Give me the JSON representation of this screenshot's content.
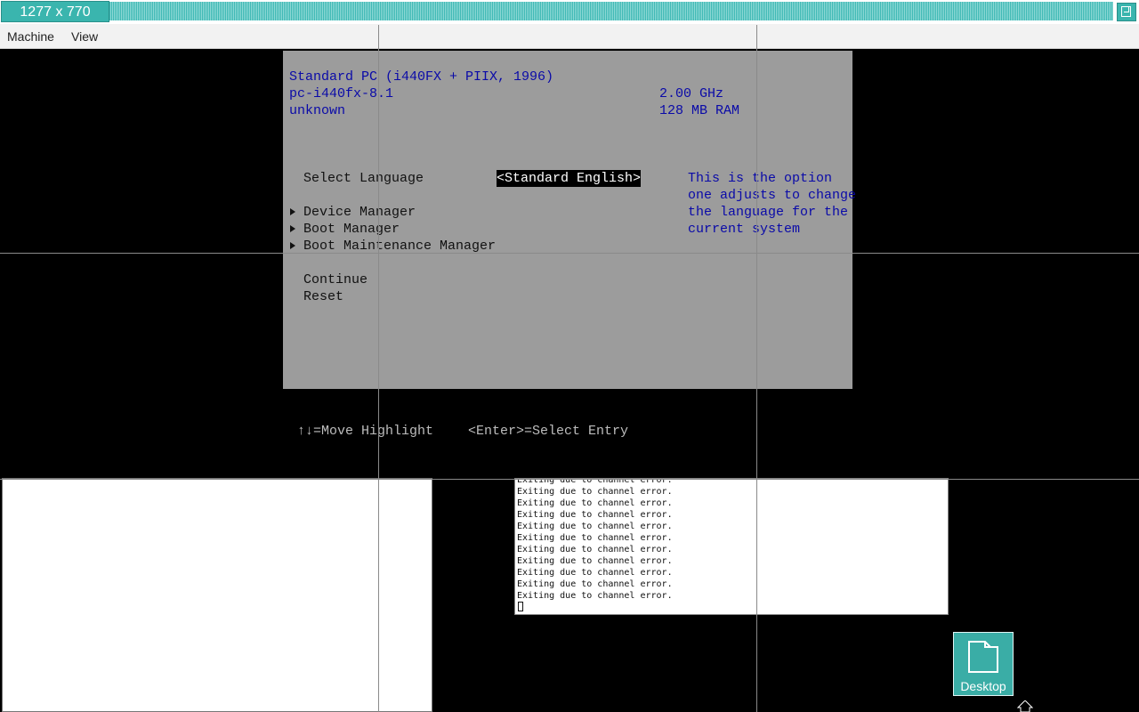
{
  "window": {
    "size_label": "1277 x 770",
    "accent": "#3ab5ae"
  },
  "menu": {
    "items": [
      "Machine",
      "View"
    ]
  },
  "bios": {
    "machine_title": "Standard PC (i440FX + PIIX, 1996)",
    "machine_type": "pc-i440fx-8.1",
    "machine_vendor": "unknown",
    "cpu_speed": "2.00 GHz",
    "ram": "128 MB RAM",
    "select_language_label": "Select Language",
    "language_value": "<Standard English>",
    "help_lines": [
      "This is the option",
      "one adjusts to change",
      "the language for the",
      "current system"
    ],
    "menu_items": [
      "Device Manager",
      "Boot Manager",
      "Boot Maintenance Manager"
    ],
    "actions": [
      "Continue",
      "Reset"
    ],
    "hint_move": "↑↓=Move Highlight",
    "hint_enter": "<Enter>=Select Entry"
  },
  "terminal": {
    "lines": [
      "Exiting due to channel error.",
      "Exiting due to channel error.",
      "Exiting due to channel error.",
      "Exiting due to channel error.",
      "Exiting due to channel error.",
      "Exiting due to channel error.",
      "Exiting due to channel error.",
      "Exiting due to channel error.",
      "Exiting due to channel error.",
      "Exiting due to channel error.",
      "Exiting due to channel error."
    ]
  },
  "desktop": {
    "icon_label": "Desktop",
    "icon_name": "folder-icon"
  }
}
